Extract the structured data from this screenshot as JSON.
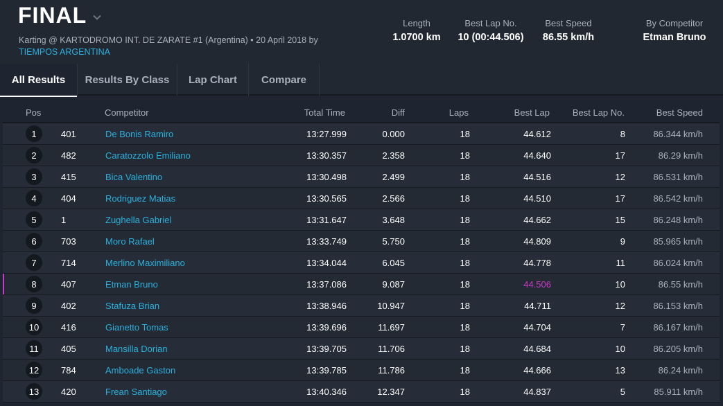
{
  "header": {
    "title": "FINAL",
    "subtitle": "Karting @ KARTODROMO INT. DE ZARATE #1 (Argentina) • 20 April 2018 by",
    "organizer": "TIEMPOS ARGENTINA",
    "stats": [
      {
        "label": "Length",
        "value": "1.0700 km"
      },
      {
        "label": "Best Lap No.",
        "value": "10 (00:44.506)"
      },
      {
        "label": "Best Speed",
        "value": "86.55 km/h"
      },
      {
        "label": "By Competitor",
        "value": "Etman Bruno"
      }
    ]
  },
  "tabs": [
    "All Results",
    "Results By Class",
    "Lap Chart",
    "Compare"
  ],
  "table": {
    "columns": [
      "Pos",
      "Competitor",
      "Total Time",
      "Diff",
      "Laps",
      "Best Lap",
      "Best Lap No.",
      "Best Speed"
    ],
    "rows": [
      {
        "pos": "1",
        "num": "401",
        "name": "De Bonis Ramiro",
        "total": "13:27.999",
        "diff": "0.000",
        "laps": "18",
        "best_lap": "44.612",
        "best_lap_no": "8",
        "best_speed": "86.344 km/h"
      },
      {
        "pos": "2",
        "num": "482",
        "name": "Caratozzolo Emiliano",
        "total": "13:30.357",
        "diff": "2.358",
        "laps": "18",
        "best_lap": "44.640",
        "best_lap_no": "17",
        "best_speed": "86.29 km/h"
      },
      {
        "pos": "3",
        "num": "415",
        "name": "Bica Valentino",
        "total": "13:30.498",
        "diff": "2.499",
        "laps": "18",
        "best_lap": "44.516",
        "best_lap_no": "12",
        "best_speed": "86.531 km/h"
      },
      {
        "pos": "4",
        "num": "404",
        "name": "Rodriguez Matias",
        "total": "13:30.565",
        "diff": "2.566",
        "laps": "18",
        "best_lap": "44.510",
        "best_lap_no": "17",
        "best_speed": "86.542 km/h"
      },
      {
        "pos": "5",
        "num": "1",
        "name": "Zughella Gabriel",
        "total": "13:31.647",
        "diff": "3.648",
        "laps": "18",
        "best_lap": "44.662",
        "best_lap_no": "15",
        "best_speed": "86.248 km/h"
      },
      {
        "pos": "6",
        "num": "703",
        "name": "Moro Rafael",
        "total": "13:33.749",
        "diff": "5.750",
        "laps": "18",
        "best_lap": "44.809",
        "best_lap_no": "9",
        "best_speed": "85.965 km/h"
      },
      {
        "pos": "7",
        "num": "714",
        "name": "Merlino Maximiliano",
        "total": "13:34.044",
        "diff": "6.045",
        "laps": "18",
        "best_lap": "44.778",
        "best_lap_no": "11",
        "best_speed": "86.024 km/h"
      },
      {
        "pos": "8",
        "num": "407",
        "name": "Etman Bruno",
        "total": "13:37.086",
        "diff": "9.087",
        "laps": "18",
        "best_lap": "44.506",
        "best_lap_no": "10",
        "best_speed": "86.55 km/h",
        "highlight": true
      },
      {
        "pos": "9",
        "num": "402",
        "name": "Stafuza Brian",
        "total": "13:38.946",
        "diff": "10.947",
        "laps": "18",
        "best_lap": "44.711",
        "best_lap_no": "12",
        "best_speed": "86.153 km/h"
      },
      {
        "pos": "10",
        "num": "416",
        "name": "Gianetto Tomas",
        "total": "13:39.696",
        "diff": "11.697",
        "laps": "18",
        "best_lap": "44.704",
        "best_lap_no": "7",
        "best_speed": "86.167 km/h"
      },
      {
        "pos": "11",
        "num": "405",
        "name": "Mansilla Dorian",
        "total": "13:39.705",
        "diff": "11.706",
        "laps": "18",
        "best_lap": "44.684",
        "best_lap_no": "10",
        "best_speed": "86.205 km/h"
      },
      {
        "pos": "12",
        "num": "784",
        "name": "Amboade Gaston",
        "total": "13:39.785",
        "diff": "11.786",
        "laps": "18",
        "best_lap": "44.666",
        "best_lap_no": "13",
        "best_speed": "86.24 km/h"
      },
      {
        "pos": "13",
        "num": "420",
        "name": "Frean Santiago",
        "total": "13:40.346",
        "diff": "12.347",
        "laps": "18",
        "best_lap": "44.837",
        "best_lap_no": "5",
        "best_speed": "85.911 km/h"
      }
    ]
  },
  "colors": {
    "accent_link": "#2ab1de",
    "best_lap_highlight": "#c93cc6",
    "background": "#1f2530"
  },
  "icons": {
    "title_dropdown": "chevron-down-icon"
  }
}
